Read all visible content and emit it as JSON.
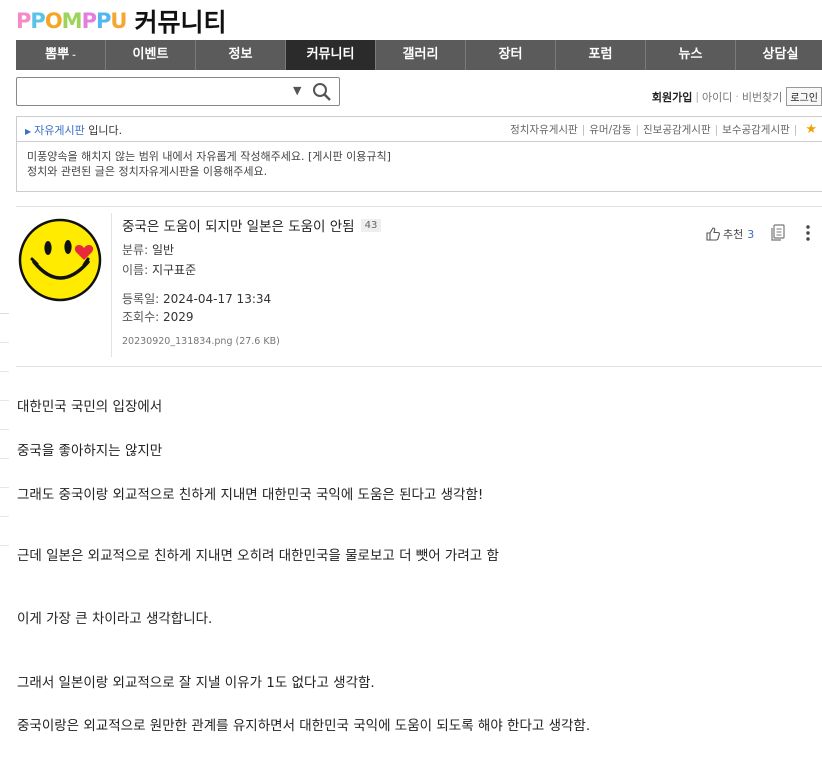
{
  "header": {
    "logo_letters": [
      "P",
      "P",
      "O",
      "M",
      "P",
      "P",
      "U"
    ],
    "logo_colors": [
      "#f58ac6",
      "#59c3e8",
      "#f5a623",
      "#9cd35a",
      "#e57ce0",
      "#54b8f0",
      "#f7a531"
    ],
    "board_name": "커뮤니티"
  },
  "nav": {
    "items": [
      {
        "label": "뽐뿌",
        "caret": "-"
      },
      {
        "label": "이벤트"
      },
      {
        "label": "정보"
      },
      {
        "label": "커뮤니티"
      },
      {
        "label": "갤러리"
      },
      {
        "label": "장터"
      },
      {
        "label": "포럼"
      },
      {
        "label": "뉴스"
      },
      {
        "label": "상담실"
      }
    ],
    "active_index": 3
  },
  "search": {
    "value": "",
    "placeholder": "",
    "dropdown_icon": "caret-down-icon",
    "icon": "search-icon"
  },
  "auth": {
    "signup": "회원가입",
    "id": "아이디",
    "pw": "비번찾기",
    "login": "로그인"
  },
  "boardbar": {
    "current_board": "자유게시판",
    "suffix": "입니다.",
    "related": [
      "정치자유게시판",
      "유머/감동",
      "진보공감게시판",
      "보수공감게시판"
    ],
    "star_icon": "star-icon"
  },
  "notice": {
    "line1": "미풍양속을 해치지 않는 범위 내에서 자유롭게 작성해주세요. [게시판 이용규칙]",
    "line2": "정치와 관련된 글은 정치자유게시판을 이용해주세요."
  },
  "post": {
    "title": "중국은 도움이 되지만 일본은 도움이 안됨",
    "comment_count": "43",
    "category_label": "분류:",
    "category": "일반",
    "author_label": "이름:",
    "author": "지구표준",
    "date_label": "등록일:",
    "date": "2024-04-17 13:34",
    "views_label": "조회수:",
    "views": "2029",
    "attachment": "20230920_131834.png (27.6 KB)",
    "recommend_label": "추천",
    "recommend_count": "3",
    "avatar": "smiley-avatar"
  },
  "body": [
    "대한민국 국민의 입장에서",
    "중국을 좋아하지는 않지만",
    "그래도 중국이랑 외교적으로 친하게 지내면 대한민국 국익에 도움은 된다고 생각함!",
    "근데 일본은 외교적으로 친하게 지내면 오히려 대한민국을 물로보고 더 뺏어 가려고 함",
    "이게 가장 큰 차이라고 생각합니다.",
    "그래서 일본이랑 외교적으로 잘 지낼 이유가 1도 없다고 생각함.",
    "중국이랑은 외교적으로 원만한 관계를 유지하면서 대한민국 국익에 도움이 되도록 해야 한다고 생각함."
  ]
}
